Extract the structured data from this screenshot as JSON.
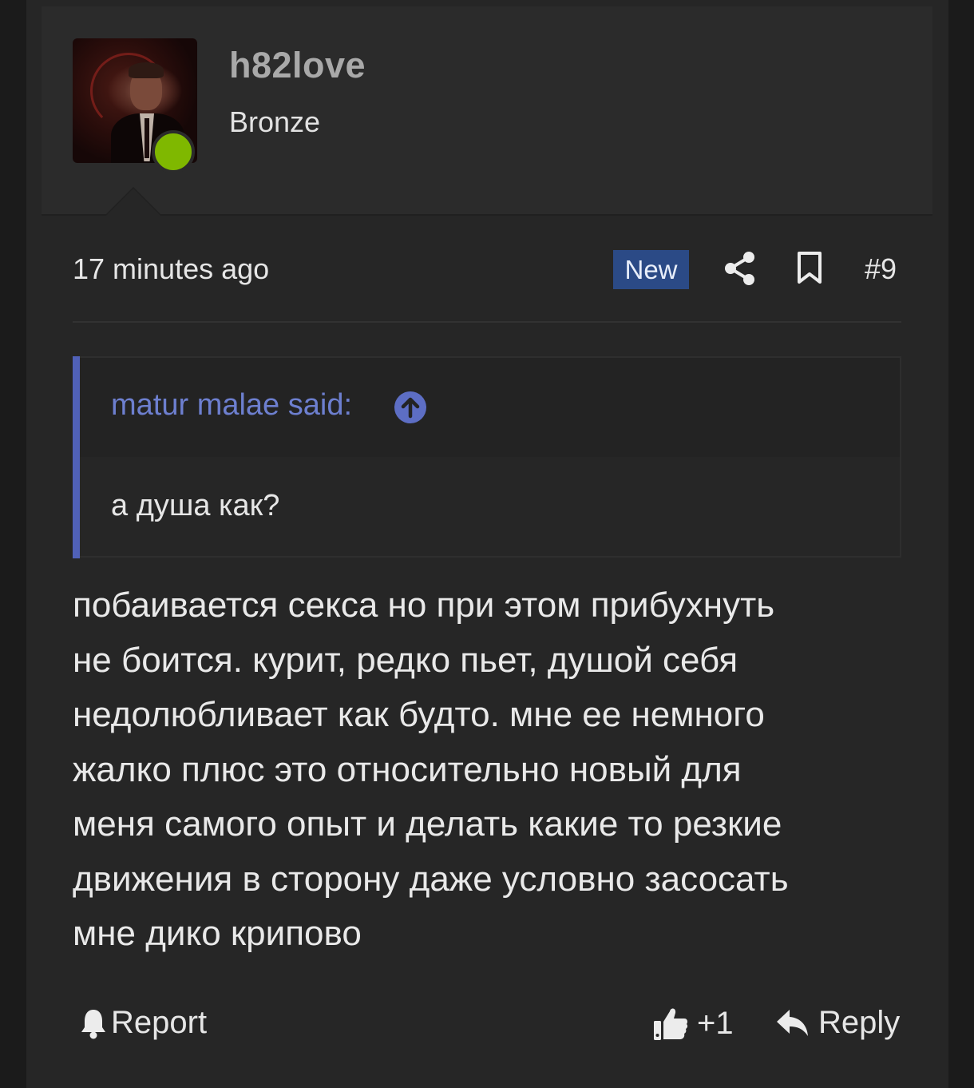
{
  "user": {
    "name": "h82love",
    "title": "Bronze",
    "status": "online"
  },
  "meta": {
    "time": "17 minutes ago",
    "badge": "New",
    "post_number": "#9"
  },
  "icons": {
    "share": "share-icon",
    "bookmark": "bookmark-icon",
    "quote_jump": "arrow-up-circle-icon",
    "report": "bell-icon",
    "like": "thumbs-up-icon",
    "reply": "reply-icon"
  },
  "quote": {
    "author": "matur malae said:",
    "text": "а душа как?"
  },
  "body": {
    "lines": [
      "побаивается секса но при этом прибухнуть",
      "не боится. курит, редко пьет, душой себя",
      "недолюбливает как будто. мне ее немного",
      "жалко плюс это относительно новый для",
      "меня самого опыт и делать какие то резкие",
      "движения в сторону даже условно засосать",
      "мне дико крипово"
    ]
  },
  "actions": {
    "report_label": "Report",
    "like_count": "+1",
    "reply_label": "Reply"
  },
  "colors": {
    "background": "#262626",
    "online": "#7fb800",
    "badge": "#2b4a86",
    "quote_accent": "#5061b8"
  }
}
